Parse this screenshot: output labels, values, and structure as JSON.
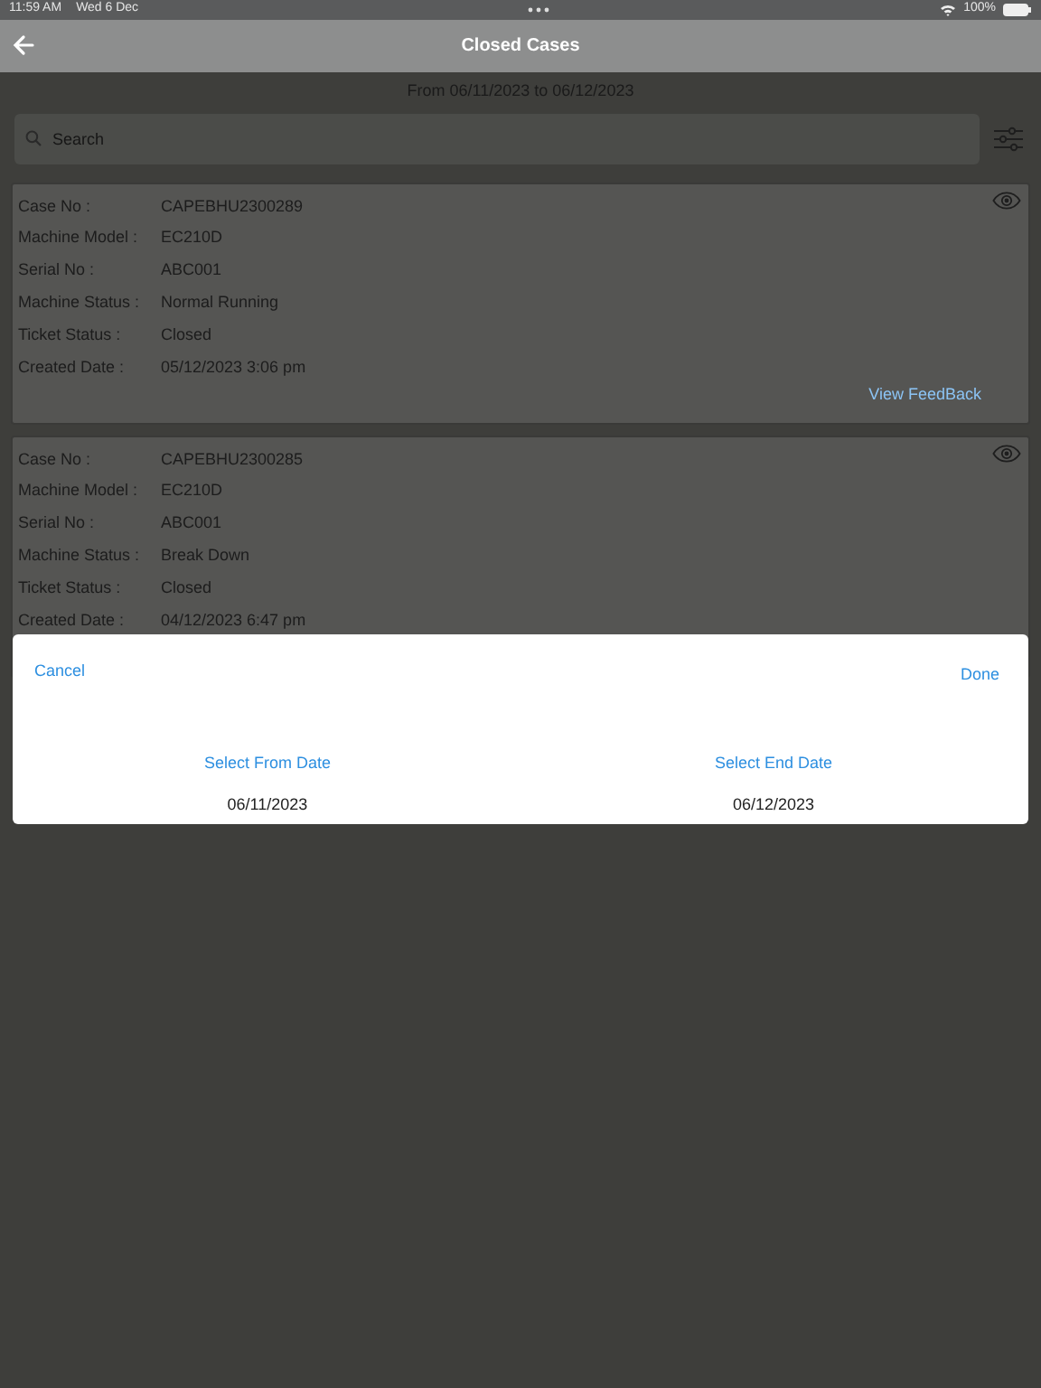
{
  "status_bar": {
    "time": "11:59 AM",
    "date": "Wed 6 Dec",
    "battery": "100%"
  },
  "nav_bar": {
    "title": "Closed Cases"
  },
  "date_range": "From 06/11/2023 to 06/12/2023",
  "search": {
    "placeholder": "Search"
  },
  "cases": [
    {
      "fields": [
        {
          "label": "Case No :",
          "value": "CAPEBHU2300289"
        },
        {
          "label": "Machine Model :",
          "value": "EC210D"
        },
        {
          "label": "Serial No :",
          "value": "ABC001"
        },
        {
          "label": "Machine Status :",
          "value": "Normal Running"
        },
        {
          "label": "Ticket Status :",
          "value": "Closed"
        },
        {
          "label": "Created Date :",
          "value": "05/12/2023 3:06 pm"
        }
      ],
      "feedback_link": "View FeedBack"
    },
    {
      "fields": [
        {
          "label": "Case No :",
          "value": "CAPEBHU2300285"
        },
        {
          "label": "Machine Model :",
          "value": "EC210D"
        },
        {
          "label": "Serial No :",
          "value": "ABC001"
        },
        {
          "label": "Machine Status :",
          "value": "Break Down"
        },
        {
          "label": "Ticket Status :",
          "value": "Closed"
        },
        {
          "label": "Created Date :",
          "value": "04/12/2023 6:47 pm"
        }
      ]
    }
  ],
  "date_picker": {
    "cancel": "Cancel",
    "done": "Done",
    "from_label": "Select From Date",
    "from_value": "06/11/2023",
    "end_label": "Select End Date",
    "end_value": "06/12/2023"
  }
}
